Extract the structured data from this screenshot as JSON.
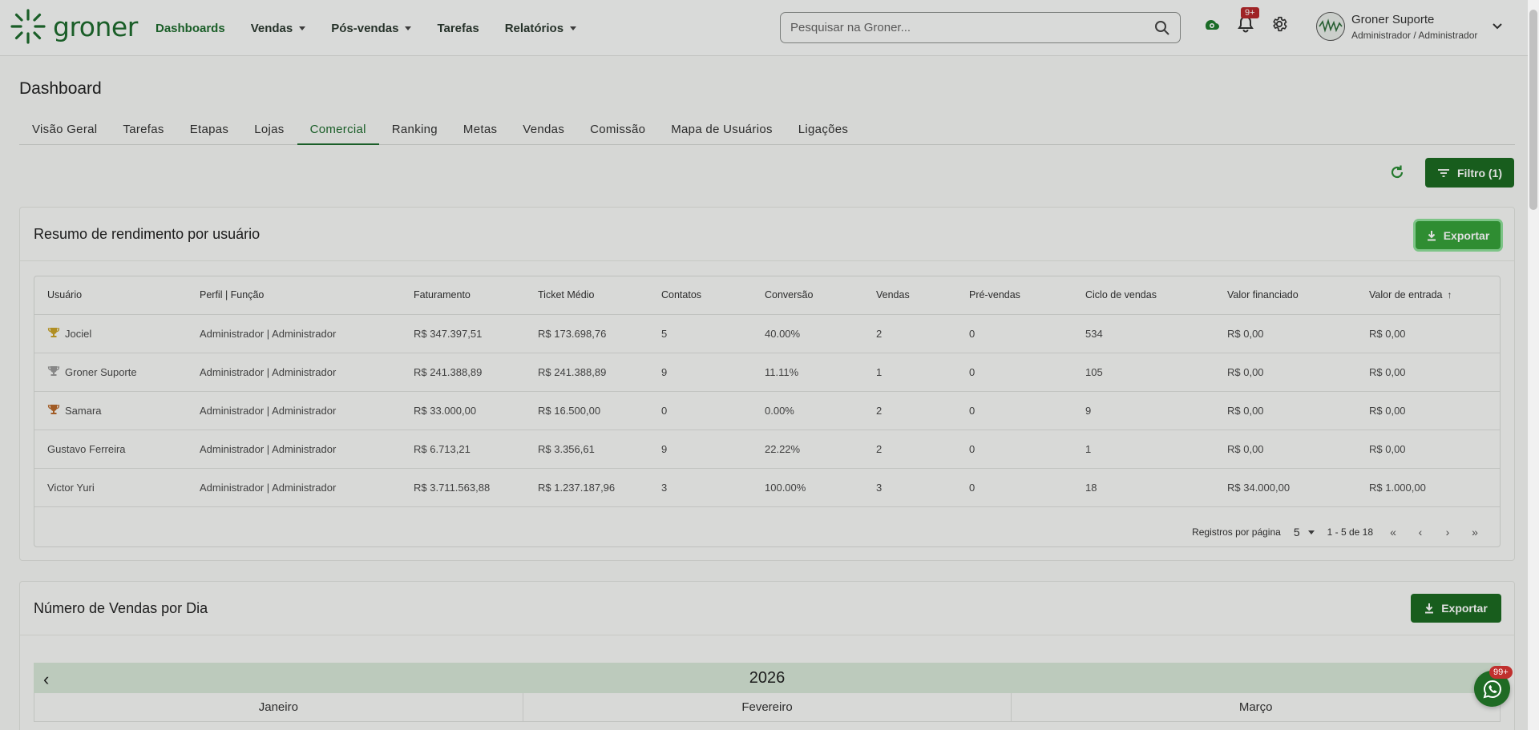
{
  "app": {
    "logo_text": "groner",
    "nav": [
      {
        "label": "Dashboards",
        "active": true,
        "has_caret": false
      },
      {
        "label": "Vendas",
        "has_caret": true
      },
      {
        "label": "Pós-vendas",
        "has_caret": true
      },
      {
        "label": "Tarefas",
        "has_caret": false
      },
      {
        "label": "Relatórios",
        "has_caret": true
      }
    ],
    "search": {
      "placeholder": "Pesquisar na Groner..."
    },
    "notifications_badge": "9+",
    "user": {
      "name": "Groner Suporte",
      "role": "Administrador / Administrador"
    },
    "accent_color": "#1e6b2e"
  },
  "page": {
    "title": "Dashboard",
    "tabs": [
      "Visão Geral",
      "Tarefas",
      "Etapas",
      "Lojas",
      "Comercial",
      "Ranking",
      "Metas",
      "Vendas",
      "Comissão",
      "Mapa de Usuários",
      "Ligações"
    ],
    "active_tab": "Comercial",
    "filter_label": "Filtro (1)"
  },
  "summary_card": {
    "title": "Resumo de rendimento por usuário",
    "export_label": "Exportar",
    "columns": [
      "Usuário",
      "Perfil | Função",
      "Faturamento",
      "Ticket Médio",
      "Contatos",
      "Conversão",
      "Vendas",
      "Pré-vendas",
      "Ciclo de vendas",
      "Valor financiado",
      "Valor de entrada"
    ],
    "sort_indicator": "↑",
    "rows": [
      {
        "user": "Jociel",
        "trophy": "gold",
        "perfil": "Administrador | Administrador",
        "faturamento": "R$ 347.397,51",
        "ticket": "R$ 173.698,76",
        "contatos": "5",
        "conversao": "40.00%",
        "vendas": "2",
        "prevendas": "0",
        "ciclo": "534",
        "financiado": "R$ 0,00",
        "entrada": "R$ 0,00"
      },
      {
        "user": "Groner Suporte",
        "trophy": "silver",
        "perfil": "Administrador | Administrador",
        "faturamento": "R$ 241.388,89",
        "ticket": "R$ 241.388,89",
        "contatos": "9",
        "conversao": "11.11%",
        "vendas": "1",
        "prevendas": "0",
        "ciclo": "105",
        "financiado": "R$ 0,00",
        "entrada": "R$ 0,00"
      },
      {
        "user": "Samara",
        "trophy": "bronze",
        "perfil": "Administrador | Administrador",
        "faturamento": "R$ 33.000,00",
        "ticket": "R$ 16.500,00",
        "contatos": "0",
        "conversao": "0.00%",
        "vendas": "2",
        "prevendas": "0",
        "ciclo": "9",
        "financiado": "R$ 0,00",
        "entrada": "R$ 0,00"
      },
      {
        "user": "Gustavo Ferreira",
        "trophy": "",
        "perfil": "Administrador | Administrador",
        "faturamento": "R$ 6.713,21",
        "ticket": "R$ 3.356,61",
        "contatos": "9",
        "conversao": "22.22%",
        "vendas": "2",
        "prevendas": "0",
        "ciclo": "1",
        "financiado": "R$ 0,00",
        "entrada": "R$ 0,00"
      },
      {
        "user": "Victor Yuri",
        "trophy": "",
        "perfil": "Administrador | Administrador",
        "faturamento": "R$ 3.711.563,88",
        "ticket": "R$ 1.237.187,96",
        "contatos": "3",
        "conversao": "100.00%",
        "vendas": "3",
        "prevendas": "0",
        "ciclo": "18",
        "financiado": "R$ 34.000,00",
        "entrada": "R$ 1.000,00"
      }
    ],
    "pagination": {
      "label": "Registros por página",
      "per_page": "5",
      "range": "1 - 5 de 18"
    }
  },
  "sales_card": {
    "title": "Número de Vendas por Dia",
    "export_label": "Exportar",
    "year": "2026",
    "months": [
      "Janeiro",
      "Fevereiro",
      "Março"
    ]
  },
  "chat_badge": "99+",
  "trophy_colors": {
    "gold": "#c9a227",
    "silver": "#9a9a9a",
    "bronze": "#b8682a"
  }
}
